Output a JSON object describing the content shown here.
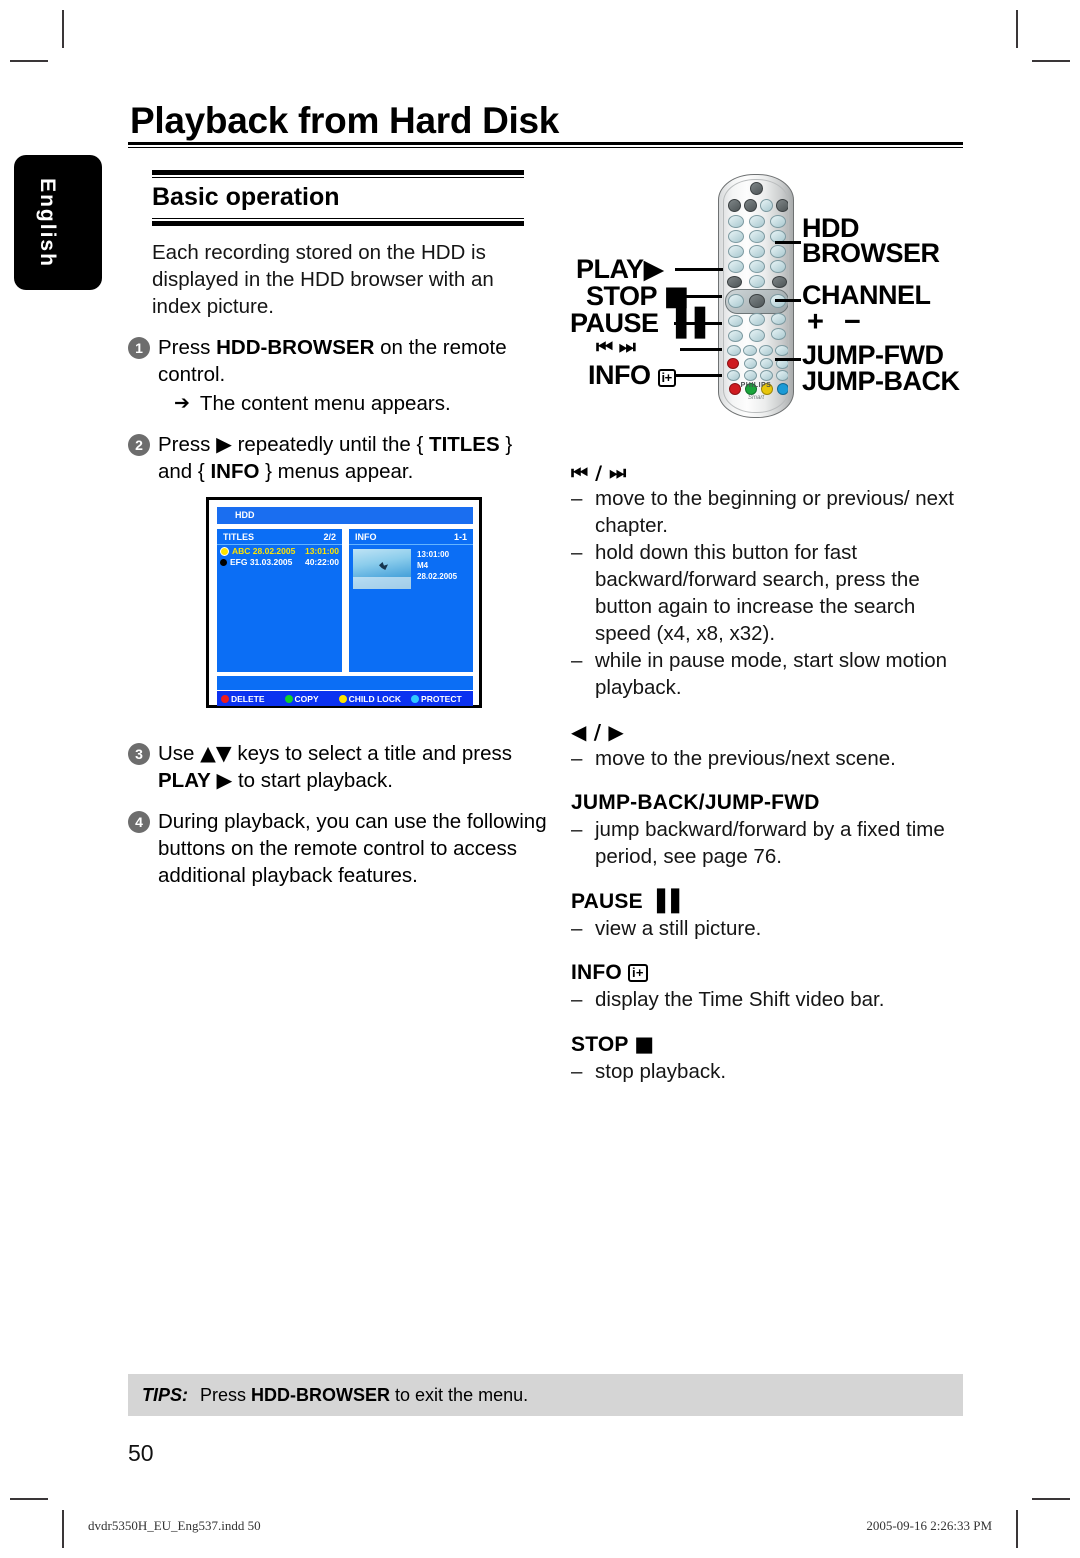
{
  "page": {
    "title": "Playback from Hard Disk",
    "section_heading": "Basic operation",
    "language_tab": "English",
    "page_number": "50"
  },
  "intro": {
    "paragraph": "Each recording stored on the HDD is displayed in the HDD browser with an index picture."
  },
  "steps": [
    {
      "num": "1",
      "text_1": "Press ",
      "bold_1": "HDD-BROWSER",
      "text_2": " on the remote control.",
      "substep_arrow": "➔",
      "substep": "The content menu appears."
    },
    {
      "num": "2",
      "text_1": "Press ",
      "glyph": "▶",
      "text_2": " repeatedly until the { ",
      "bold_1": "TITLES",
      "text_3": " } and { ",
      "bold_2": "INFO",
      "text_4": " } menus appear."
    },
    {
      "num": "3",
      "text_1": "Use ",
      "glyph": "▲▼",
      "text_2": " keys to select a title and press ",
      "bold_1": "PLAY",
      "glyph_2": "▶",
      "text_3": " to start playback."
    },
    {
      "num": "4",
      "text_1": "During playback, you can use the following buttons on the remote control to access additional playback features."
    }
  ],
  "tv_screen": {
    "hdd_bar_label": "HDD",
    "titles_panel": {
      "header_label": "TITLES",
      "header_suffix": "│",
      "header_count": "2/2",
      "rows": [
        {
          "name": "ABC 28.02.2005",
          "time": "13:01:00",
          "selected": true,
          "bullet_color": "#ffe400"
        },
        {
          "name": "EFG 31.03.2005",
          "time": "40:22:00",
          "selected": false,
          "bullet_color": "#000000"
        }
      ]
    },
    "info_panel": {
      "header_label": "INFO",
      "header_suffix": "│",
      "header_count": "1-1",
      "meta": [
        "13:01:00",
        "M4",
        "28.02.2005"
      ]
    },
    "color_buttons": [
      {
        "label": "DELETE",
        "color": "#ee1c1c"
      },
      {
        "label": "COPY",
        "color": "#12d22a"
      },
      {
        "label": "CHILD LOCK",
        "color": "#ffe400"
      },
      {
        "label": "PROTECT",
        "color": "#2fc8ff"
      }
    ]
  },
  "remote_figure": {
    "labels_left": [
      {
        "id": "play",
        "text": "PLAY",
        "glyph": "▶"
      },
      {
        "id": "stop",
        "text": "STOP",
        "glyph": "■"
      },
      {
        "id": "pause",
        "text": "PAUSE",
        "glyph": "▐▐"
      },
      {
        "id": "skip",
        "text": "",
        "glyph": "⏮  ⏭"
      },
      {
        "id": "info",
        "text": "INFO",
        "glyph": "i+"
      }
    ],
    "labels_right": [
      {
        "id": "hdd-browser-1",
        "text": "HDD"
      },
      {
        "id": "hdd-browser-2",
        "text": "BROWSER"
      },
      {
        "id": "channel",
        "text": "CHANNEL"
      },
      {
        "id": "channel-pm",
        "text": "+ −"
      },
      {
        "id": "jump-fwd",
        "text": "JUMP-FWD"
      },
      {
        "id": "jump-back",
        "text": "JUMP-BACK"
      }
    ],
    "brand": "PHILIPS",
    "brand_sub": "Smart"
  },
  "descriptions": [
    {
      "id": "skip-keys",
      "heading_glyph": "⏮ / ⏭",
      "heading_text": "",
      "lines": [
        "move to the beginning or previous/ next chapter.",
        "hold down this button for fast backward/forward search, press the button again to increase the search speed (x4, x8, x32).",
        "while in pause mode, start slow motion playback."
      ]
    },
    {
      "id": "arrow-keys",
      "heading_glyph": "◀ / ▶",
      "heading_text": "",
      "lines": [
        "move to the previous/next scene."
      ]
    },
    {
      "id": "jump-keys",
      "heading_glyph": "",
      "heading_text": "JUMP-BACK/JUMP-FWD",
      "lines": [
        "jump backward/forward by a fixed time period, see page 76."
      ]
    },
    {
      "id": "pause-key",
      "heading_glyph": "▐▐",
      "heading_text": "PAUSE",
      "lines": [
        "view a still picture."
      ]
    },
    {
      "id": "info-key",
      "heading_glyph": "i+",
      "heading_text": "INFO",
      "lines": [
        "display the Time Shift video bar."
      ]
    },
    {
      "id": "stop-key",
      "heading_glyph": "■",
      "heading_text": "STOP",
      "lines": [
        "stop playback."
      ]
    }
  ],
  "tips": {
    "label": "TIPS:",
    "text_1": "Press ",
    "bold": "HDD-BROWSER",
    "text_2": " to exit the menu."
  },
  "footer": {
    "left": "dvdr5350H_EU_Eng537.indd   50",
    "right": "2005-09-16   2:26:33 PM"
  }
}
